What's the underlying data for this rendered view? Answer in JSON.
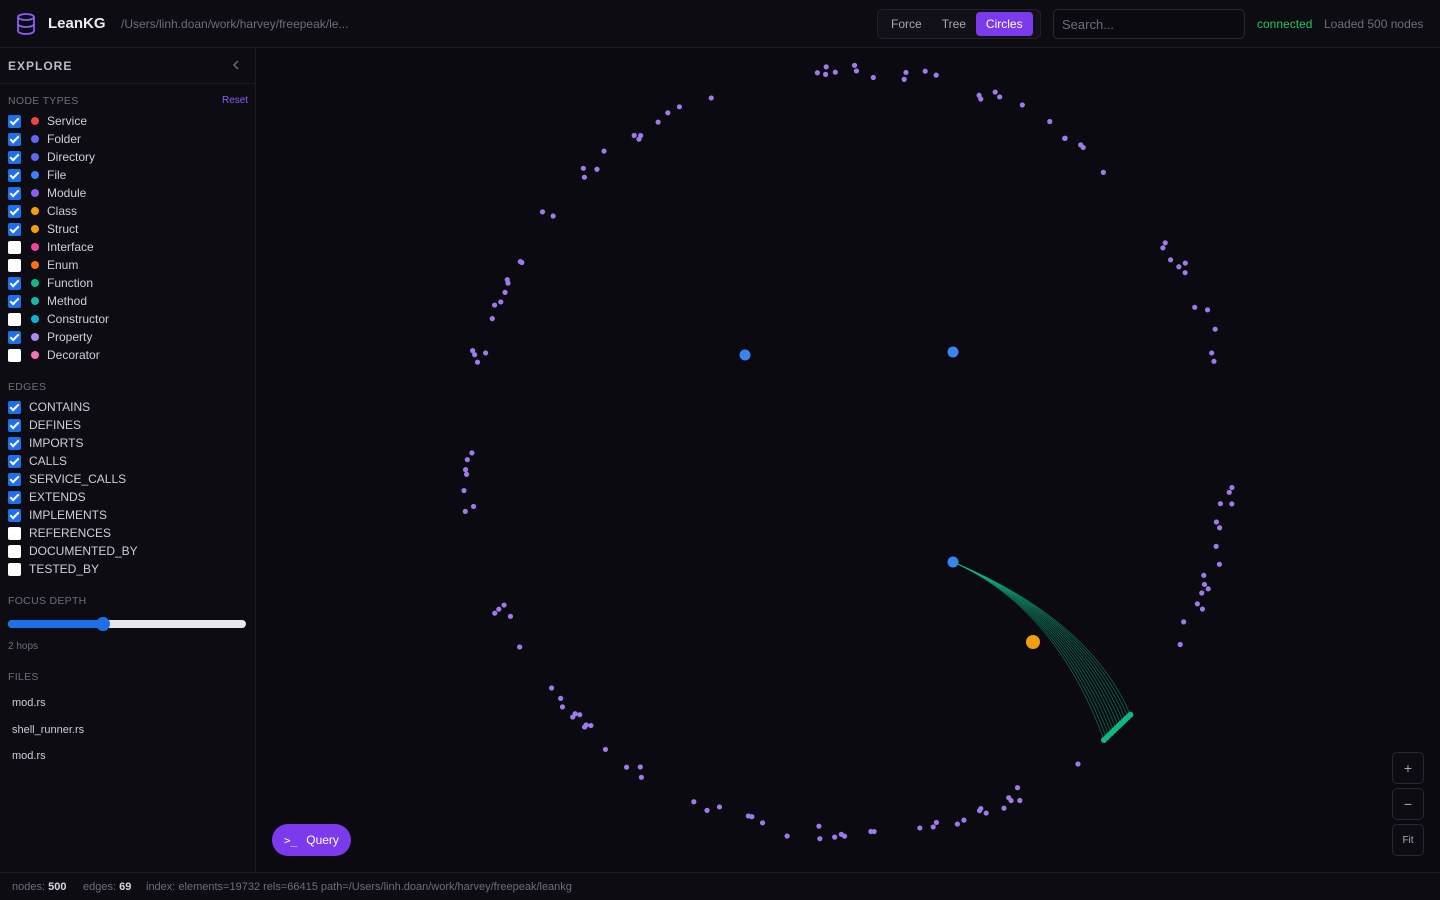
{
  "header": {
    "brand": "LeanKG",
    "path": "/Users/linh.doan/work/harvey/freepeak/le...",
    "view_tabs": [
      {
        "label": "Force",
        "active": false
      },
      {
        "label": "Tree",
        "active": false
      },
      {
        "label": "Circles",
        "active": true
      }
    ],
    "search_placeholder": "Search...",
    "status": "connected",
    "loaded": "Loaded 500 nodes"
  },
  "sidebar": {
    "title": "EXPLORE",
    "node_types_title": "NODE TYPES",
    "reset_label": "Reset",
    "node_types": [
      {
        "label": "Service",
        "checked": true,
        "color": "#ef4444"
      },
      {
        "label": "Folder",
        "checked": true,
        "color": "#6366f1"
      },
      {
        "label": "Directory",
        "checked": true,
        "color": "#6366f1"
      },
      {
        "label": "File",
        "checked": true,
        "color": "#3b82f6"
      },
      {
        "label": "Module",
        "checked": true,
        "color": "#8b5cf6"
      },
      {
        "label": "Class",
        "checked": true,
        "color": "#f59e0b"
      },
      {
        "label": "Struct",
        "checked": true,
        "color": "#f59e0b"
      },
      {
        "label": "Interface",
        "checked": false,
        "color": "#ec4899"
      },
      {
        "label": "Enum",
        "checked": false,
        "color": "#f97316"
      },
      {
        "label": "Function",
        "checked": true,
        "color": "#10b981"
      },
      {
        "label": "Method",
        "checked": true,
        "color": "#14b8a6"
      },
      {
        "label": "Constructor",
        "checked": false,
        "color": "#06b6d4"
      },
      {
        "label": "Property",
        "checked": true,
        "color": "#a78bfa"
      },
      {
        "label": "Decorator",
        "checked": false,
        "color": "#f472b6"
      }
    ],
    "edges_title": "EDGES",
    "edges": [
      {
        "label": "CONTAINS",
        "checked": true
      },
      {
        "label": "DEFINES",
        "checked": true
      },
      {
        "label": "IMPORTS",
        "checked": true
      },
      {
        "label": "CALLS",
        "checked": true
      },
      {
        "label": "SERVICE_CALLS",
        "checked": true
      },
      {
        "label": "EXTENDS",
        "checked": true
      },
      {
        "label": "IMPLEMENTS",
        "checked": true
      },
      {
        "label": "REFERENCES",
        "checked": false
      },
      {
        "label": "DOCUMENTED_BY",
        "checked": false
      },
      {
        "label": "TESTED_BY",
        "checked": false
      }
    ],
    "focus_depth_title": "FOCUS DEPTH",
    "focus_depth_value": 2,
    "focus_depth_fraction": 0.4,
    "hops_label": "2 hops",
    "files_title": "FILES",
    "files": [
      "mod.rs",
      "shell_runner.rs",
      "mod.rs"
    ]
  },
  "canvas": {
    "query_label": "Query",
    "query_icon": "terminal-icon",
    "zoom_in": "+",
    "zoom_out": "−",
    "fit": "Fit",
    "node_color": "#9f7aea",
    "file_color": "#3b82f6",
    "struct_color": "#f59e0b",
    "function_color": "#10b981"
  },
  "footer": {
    "nodes_label": "nodes:",
    "nodes_value": "500",
    "edges_label": "edges:",
    "edges_value": "69",
    "index": "index: elements=19732 rels=66415 path=/Users/linh.doan/work/harvey/freepeak/leankg"
  }
}
